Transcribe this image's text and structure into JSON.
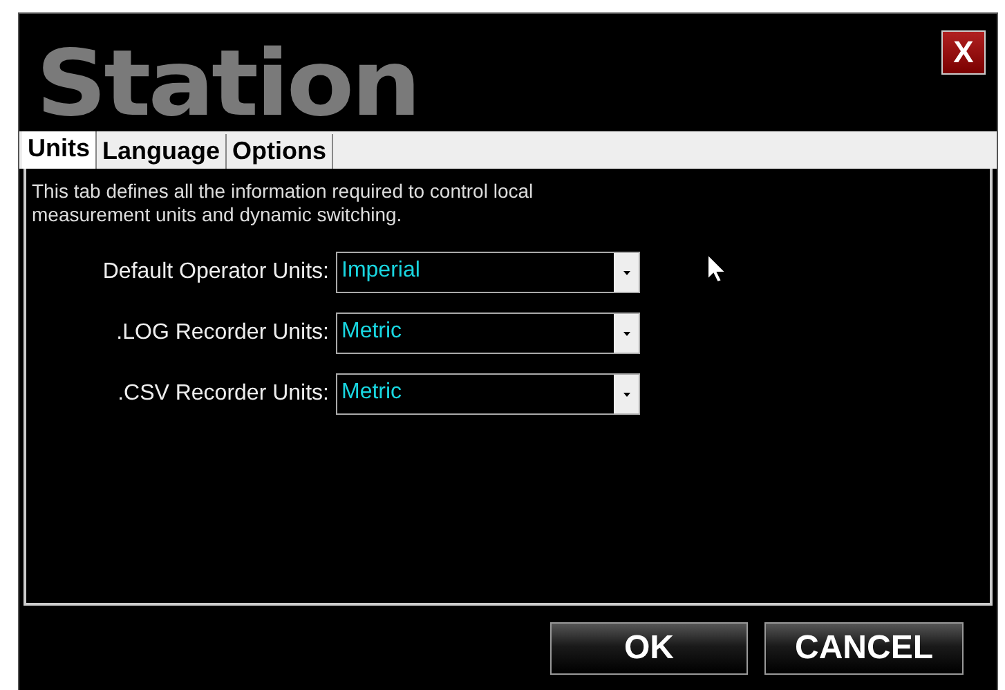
{
  "window": {
    "title": "Station",
    "close_label": "X"
  },
  "tabs": [
    {
      "label": "Units",
      "selected": true
    },
    {
      "label": "Language",
      "selected": false
    },
    {
      "label": "Options",
      "selected": false
    }
  ],
  "description": "This tab defines all the information required to control local measurement units and dynamic switching.",
  "fields": [
    {
      "label": "Default Operator Units:",
      "value": "Imperial"
    },
    {
      "label": ".LOG Recorder Units:",
      "value": "Metric"
    },
    {
      "label": ".CSV Recorder Units:",
      "value": "Metric"
    }
  ],
  "buttons": [
    "OK",
    "CANCEL"
  ]
}
